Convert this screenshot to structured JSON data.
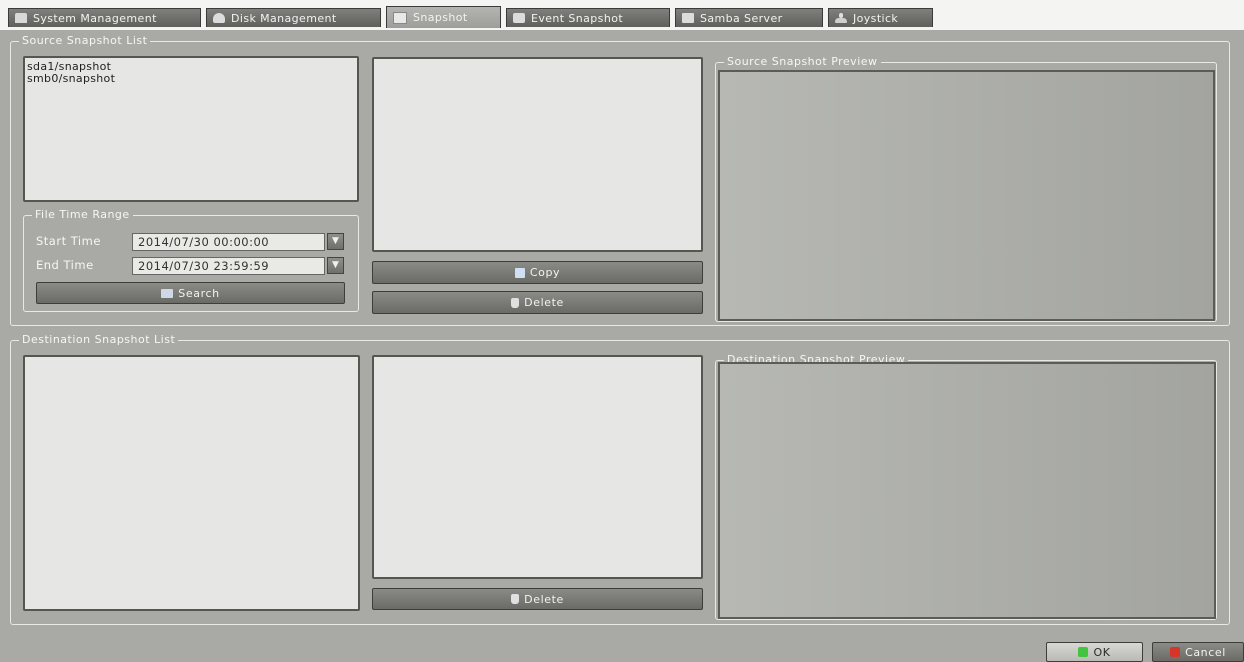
{
  "tabs": [
    {
      "label": "System Management",
      "icon": "monitor-icon",
      "active": false
    },
    {
      "label": "Disk Management",
      "icon": "disk-icon",
      "active": false
    },
    {
      "label": "Snapshot",
      "icon": "snapshot-icon",
      "active": true
    },
    {
      "label": "Event Snapshot",
      "icon": "event-snapshot-icon",
      "active": false
    },
    {
      "label": "Samba Server",
      "icon": "samba-icon",
      "active": false
    },
    {
      "label": "Joystick",
      "icon": "joystick-icon",
      "active": false
    }
  ],
  "source": {
    "title": "Source Snapshot List",
    "items": [
      "sda1/snapshot",
      "smb0/snapshot"
    ],
    "time_range": {
      "title": "File Time Range",
      "start_label": "Start Time",
      "start_value": "2014/07/30 00:00:00",
      "end_label": "End Time",
      "end_value": "2014/07/30 23:59:59"
    },
    "search_label": "Search",
    "copy_label": "Copy",
    "delete_label": "Delete",
    "preview_title": "Source Snapshot Preview"
  },
  "destination": {
    "title": "Destination Snapshot List",
    "delete_label": "Delete",
    "preview_title": "Destination Snapshot Preview"
  },
  "footer": {
    "ok_label": "OK",
    "cancel_label": "Cancel"
  },
  "colors": {
    "background": "#a9aaa5",
    "tabbar": "#f4f4f2",
    "button": "#7a7b76",
    "ok_icon": "#43c43e",
    "cancel_icon": "#d8352a"
  }
}
